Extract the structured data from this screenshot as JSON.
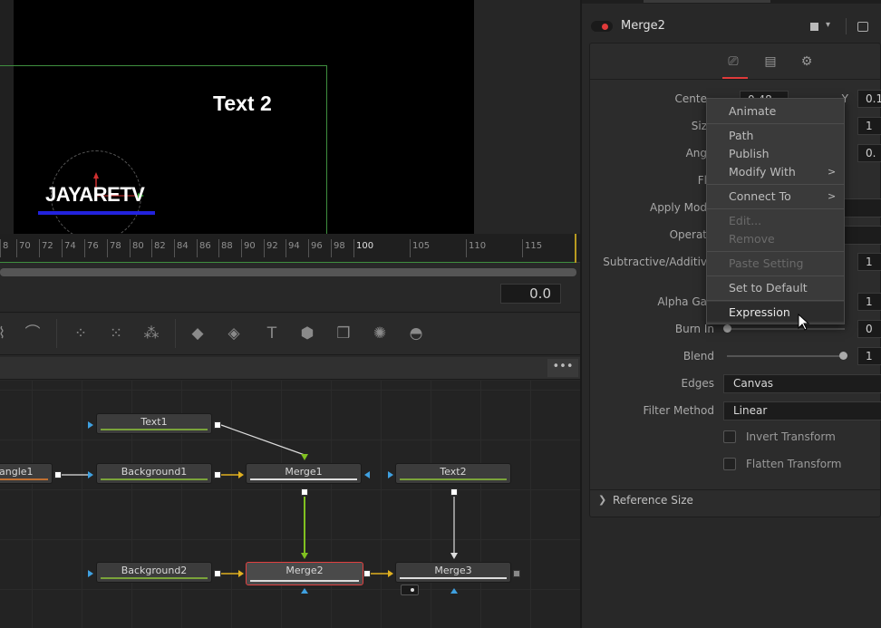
{
  "viewer": {
    "overlay_text": "Text 2",
    "logo_text": "JAYARETV"
  },
  "timeline": {
    "ruler_ticks": [
      "8",
      "70",
      "72",
      "74",
      "76",
      "78",
      "80",
      "82",
      "84",
      "86",
      "88",
      "90",
      "92",
      "94",
      "96",
      "98",
      "100",
      "105",
      "110",
      "115"
    ],
    "current_time": "0.0"
  },
  "toolbar": {
    "tools": [
      "bezier-tool-icon",
      "curve-tool-icon",
      "particle-emitter-icon",
      "particle-render-icon",
      "particle-grid-icon",
      "image-plane-icon",
      "shape-3d-icon",
      "text-3d-icon",
      "merge-3d-icon",
      "renderer-3d-icon",
      "spotlight-icon",
      "camera-3d-icon"
    ],
    "more_label": "•••"
  },
  "flow": {
    "nodes": [
      {
        "id": "text1",
        "label": "Text1"
      },
      {
        "id": "rectangle1",
        "label": "angle1"
      },
      {
        "id": "background1",
        "label": "Background1"
      },
      {
        "id": "merge1",
        "label": "Merge1"
      },
      {
        "id": "text2",
        "label": "Text2"
      },
      {
        "id": "background2",
        "label": "Background2"
      },
      {
        "id": "merge2",
        "label": "Merge2"
      },
      {
        "id": "merge3",
        "label": "Merge3"
      }
    ]
  },
  "inspector": {
    "node_name": "Merge2",
    "accent_color": "#e03a3a",
    "rows": {
      "center_label": "Cente",
      "center_x": "0.48",
      "center_y_label": "Y",
      "center_y": "0.1",
      "size_label": "Siz",
      "size_value": "1",
      "angle_label": "Ang",
      "angle_value": "0.",
      "flip_label": "Fl",
      "apply_mode_label": "Apply Mod",
      "operator_label": "Operat",
      "sub_add_label": "Subtractive/Additiv",
      "sub_add_value": "1",
      "alpha_gain_label": "Alpha Ga",
      "alpha_gain_value": "1",
      "burn_in_label": "Burn In",
      "burn_in_value": "0",
      "blend_label": "Blend",
      "blend_value": "1",
      "edges_label": "Edges",
      "edges_value": "Canvas",
      "filter_label": "Filter Method",
      "filter_value": "Linear",
      "invert_transform": "Invert Transform",
      "flatten_transform": "Flatten Transform"
    },
    "reference_size": "Reference Size"
  },
  "context_menu": {
    "items": {
      "animate": "Animate",
      "path": "Path",
      "publish": "Publish",
      "modify_with": "Modify With",
      "connect_to": "Connect To",
      "edit": "Edit...",
      "remove": "Remove",
      "paste_setting": "Paste Setting",
      "set_to_default": "Set to Default",
      "expression": "Expression"
    },
    "submenu_arrow": ">"
  }
}
